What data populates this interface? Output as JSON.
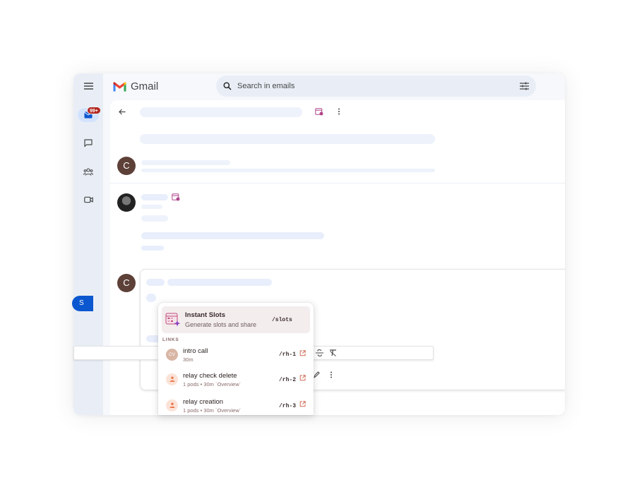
{
  "app": {
    "name": "Gmail",
    "mail_badge": "99+",
    "contact_initial": "C"
  },
  "search": {
    "placeholder": "Search in emails"
  },
  "popup": {
    "feature": {
      "title": "Instant Slots",
      "subtitle": "Generate slots and share",
      "shortcut": "/slots"
    },
    "section_label": "LINKS",
    "items": [
      {
        "avatar": "CV",
        "title": "intro call",
        "subtitle": "30m",
        "shortcut": "/rh-1"
      },
      {
        "avatar": "",
        "title": "relay check delete",
        "subtitle": "1 pods • 30m `Overview`",
        "shortcut": "/rh-2"
      },
      {
        "avatar": "",
        "title": "relay creation",
        "subtitle": "1 pods • 30m `Overview`",
        "shortcut": "/rh-3"
      }
    ]
  },
  "compose": {
    "send_partial": "S"
  },
  "colors": {
    "accent": "#0b57d0",
    "badge": "#b3261e",
    "avatar": "#5d4037",
    "brand_popup": "#f3edee"
  }
}
